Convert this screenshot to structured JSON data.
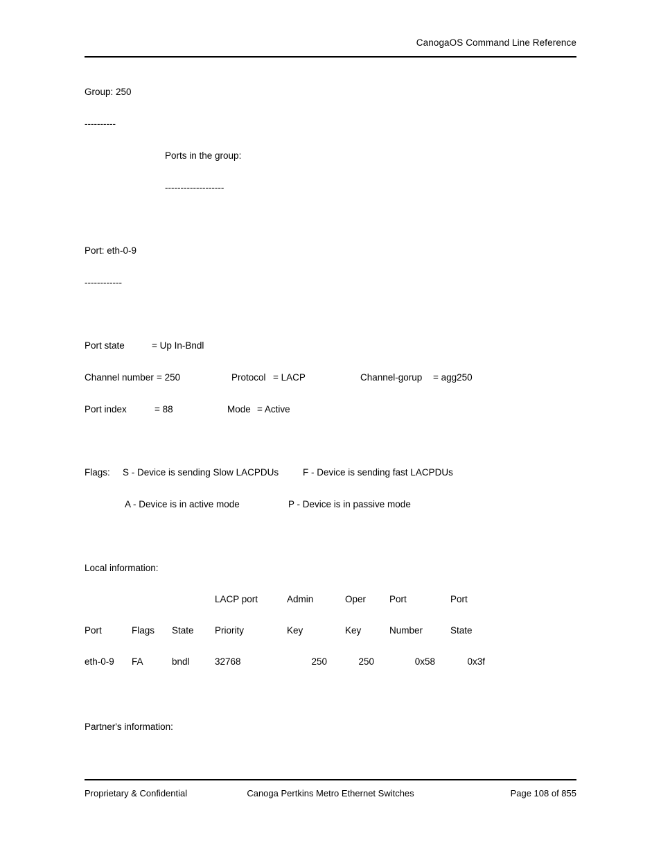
{
  "header": {
    "title": "CanogaOS Command Line Reference"
  },
  "body": {
    "group_line": "Group: 250",
    "group_rule": "----------",
    "ports_in_group_label": "Ports in the group:",
    "ports_in_group_rule": "-------------------",
    "port_line": "Port: eth-0-9",
    "port_rule": "------------",
    "port_state": {
      "label": "Port state",
      "value": "= Up In-Bndl"
    },
    "channel_row": {
      "channel_number_label": "Channel number",
      "channel_number_value": "= 250",
      "protocol_label": "Protocol",
      "protocol_value": "= LACP",
      "channel_group_label": "Channel-gorup",
      "channel_group_value": "= agg250"
    },
    "port_index_row": {
      "port_index_label": "Port index",
      "port_index_value": "= 88",
      "mode_label": "Mode",
      "mode_value": "= Active"
    },
    "flags": {
      "label": "Flags:",
      "slow": "S - Device is sending Slow LACPDUs",
      "fast": "F - Device is sending fast LACPDUs",
      "active": "A - Device is in active mode",
      "passive": "P - Device is in passive mode"
    },
    "local_information_label": "Local information:",
    "partner_information_label": "Partner's information:"
  },
  "local_table": {
    "header_row_1": {
      "port": "",
      "flags": "",
      "state": "",
      "priority": "LACP port",
      "admin": "Admin",
      "oper": "Oper",
      "number": "Port",
      "pstate": "Port"
    },
    "header_row_2": {
      "port": "Port",
      "flags": "Flags",
      "state": "State",
      "priority": "Priority",
      "admin": "Key",
      "oper": "Key",
      "number": "Number",
      "pstate": "State"
    },
    "rows": [
      {
        "port": "eth-0-9",
        "flags": "FA",
        "state": "bndl",
        "priority": "32768",
        "admin": "250",
        "oper": "250",
        "number": "0x58",
        "pstate": "0x3f"
      }
    ]
  },
  "footer": {
    "left": "Proprietary & Confidential",
    "center": "Canoga Pertkins Metro Ethernet Switches",
    "right": "Page 108 of 855"
  }
}
